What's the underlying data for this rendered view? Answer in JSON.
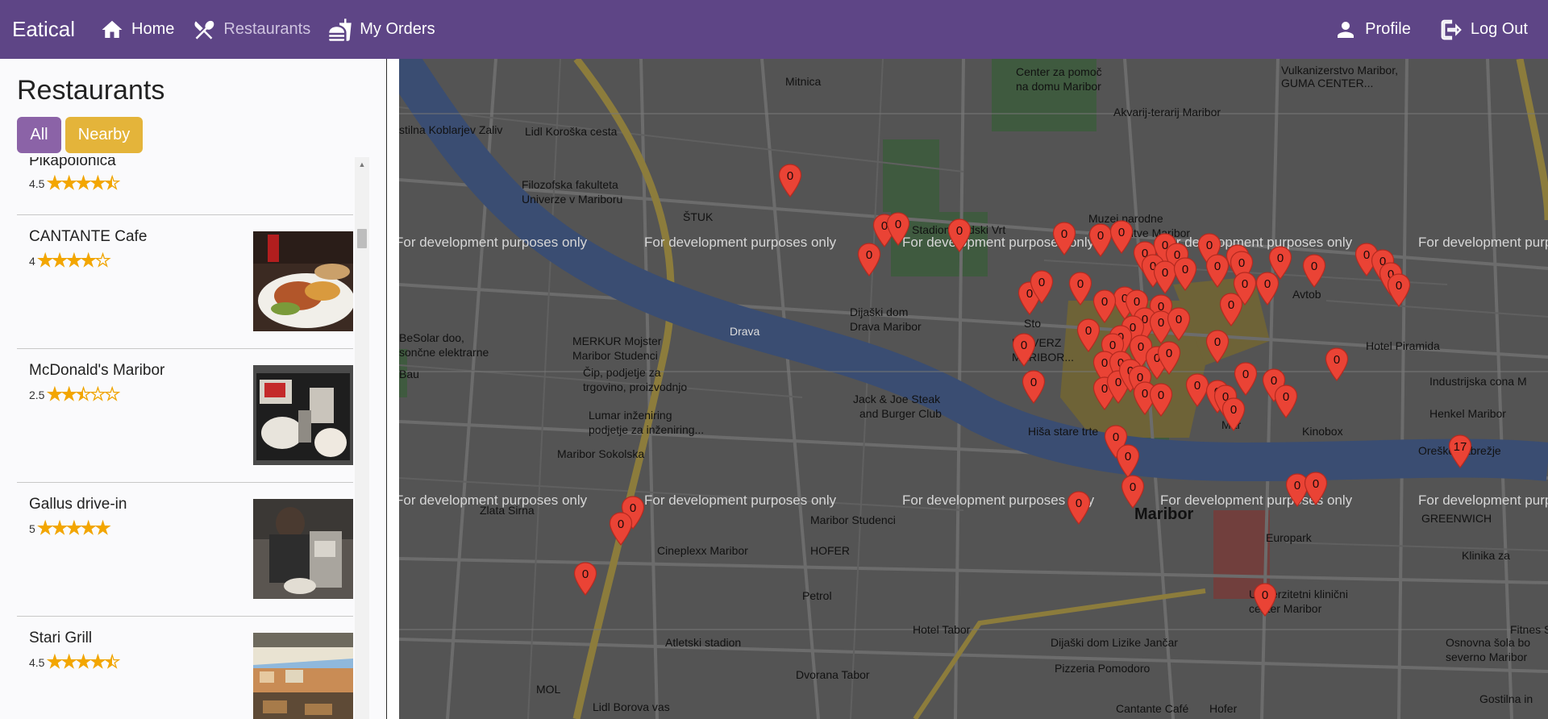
{
  "nav": {
    "brand": "Eatical",
    "home_label": "Home",
    "restaurants_label": "Restaurants",
    "orders_label": "My Orders",
    "profile_label": "Profile",
    "logout_label": "Log Out",
    "color": "#5e4586"
  },
  "sidebar": {
    "title": "Restaurants",
    "filter_all": "All",
    "filter_nearby": "Nearby",
    "restaurants": [
      {
        "name": "Pikapolonica",
        "rating": "4.5",
        "rating_value": 4.5
      },
      {
        "name": "CANTANTE Cafe",
        "rating": "4",
        "rating_value": 4,
        "thumb": "food-plate"
      },
      {
        "name": "McDonald's Maribor",
        "rating": "2.5",
        "rating_value": 2.5,
        "thumb": "fastfood-tray"
      },
      {
        "name": "Gallus drive-in",
        "rating": "5",
        "rating_value": 5,
        "thumb": "coffee-barista"
      },
      {
        "name": "Stari Grill",
        "rating": "4.5",
        "rating_value": 4.5,
        "thumb": "terrace"
      }
    ]
  },
  "map": {
    "watermark": "For development purposes only",
    "labels": {
      "mitnica": "Mitnica",
      "center_pomoc": "Center za pomoč",
      "na_domu": "na domu Maribor",
      "vulkan": "Vulkanizerstvo Maribor,",
      "guma": "GUMA CENTER...",
      "akvarij": "Akvarij-terarij Maribor",
      "lidl_koroska": "Lidl Koroška cesta",
      "filozofska": "Filozofska fakulteta",
      "univerze": "Univerze v Mariboru",
      "stuk": "ŠTUK",
      "stadion": "Stadion Ljudski Vrt",
      "muzej": "Muzej narodne",
      "osvoboditve": "osvoboditve Maribor",
      "dijaski_drava": "Dijaški dom",
      "drava_maribor": "Drava Maribor",
      "mercator": "MERKUR Mojster",
      "mercator2": "Maribor Studenci",
      "besolar": "BeSolar doo,",
      "besolar2": "sončne elektrarne",
      "cip": "Čip, podjetje za",
      "cip2": "trgovino, proizvodnjo",
      "lumar": "Lumar inženiring",
      "lumar2": "podjetje za inženiring...",
      "jack": "Jack & Joe Steak",
      "jack2": "and Burger Club",
      "hisa": "Hiša stare trte",
      "maribor_sokolska": "Maribor Sokolska",
      "zlata_sirna": "Zlata Sirna",
      "maribor_studenci": "Maribor Studenci",
      "cineplexx": "Cineplexx Maribor",
      "hofer": "HOFER",
      "petrol": "Petrol",
      "maribor": "Maribor",
      "europark": "Europark",
      "ukc": "Univerzitetni klinični",
      "ukc2": "center Maribor",
      "kinobox": "Kinobox",
      "hotel_piramida": "Hotel Piramida",
      "industrijska": "Industrijska cona M",
      "henkel": "Henkel Maribor",
      "oresko": "Oreško nabrežje",
      "greenwich": "GREENWICH",
      "klinika": "Klinika za",
      "atletski": "Atletski stadion",
      "hotel_tabor": "Hotel Tabor",
      "dvorana": "Dvorana Tabor",
      "dijaski_jancar": "Dijaški dom Lizike Jančar",
      "pizzeria": "Pizzeria Pomodoro",
      "cantante": "Cantante Café",
      "mol": "MOL",
      "lidl_borova": "Lidl Borova vas",
      "fitnes": "Fitnes Stu",
      "osnovna": "Osnovna šola bo",
      "osnovna2": "severno Maribor",
      "kostilna": "Gostilna in",
      "hofer2": "Hofer",
      "bau": "Bau",
      "kostilna_kob": "stilna Koblarjev Zaliv",
      "drava_river": "Drava",
      "avtob": "Avtob",
      "stoj": "Sto",
      "univerza": "UNIVERZ",
      "univerza2": "MARIBOR...",
      "bar_m": "Mar"
    },
    "markers": [
      {
        "label": "0"
      },
      {
        "label": "0"
      },
      {
        "label": "0"
      },
      {
        "label": "0"
      },
      {
        "label": "0"
      },
      {
        "label": "0"
      },
      {
        "label": "0"
      },
      {
        "label": "0"
      },
      {
        "label": "0"
      },
      {
        "label": "0"
      },
      {
        "label": "0"
      },
      {
        "label": "0"
      },
      {
        "label": "0"
      },
      {
        "label": "0"
      },
      {
        "label": "0"
      },
      {
        "label": "0"
      },
      {
        "label": "0"
      },
      {
        "label": "0"
      },
      {
        "label": "0"
      },
      {
        "label": "0"
      },
      {
        "label": "0"
      },
      {
        "label": "0"
      },
      {
        "label": "0"
      },
      {
        "label": "0"
      },
      {
        "label": "0"
      },
      {
        "label": "0"
      },
      {
        "label": "0"
      },
      {
        "label": "0"
      },
      {
        "label": "0"
      },
      {
        "label": "0"
      },
      {
        "label": "0"
      },
      {
        "label": "0"
      },
      {
        "label": "0"
      },
      {
        "label": "0"
      },
      {
        "label": "0"
      },
      {
        "label": "0"
      },
      {
        "label": "0"
      },
      {
        "label": "0"
      },
      {
        "label": "0"
      },
      {
        "label": "0"
      },
      {
        "label": "0"
      },
      {
        "label": "0"
      },
      {
        "label": "0"
      },
      {
        "label": "0"
      },
      {
        "label": "0"
      },
      {
        "label": "0"
      },
      {
        "label": "0"
      },
      {
        "label": "0"
      },
      {
        "label": "0"
      },
      {
        "label": "0"
      },
      {
        "label": "0"
      },
      {
        "label": "0"
      },
      {
        "label": "0"
      },
      {
        "label": "0"
      },
      {
        "label": "0"
      },
      {
        "label": "0"
      },
      {
        "label": "0"
      },
      {
        "label": "0"
      },
      {
        "label": "0"
      },
      {
        "label": "0"
      },
      {
        "label": "0"
      },
      {
        "label": "0"
      },
      {
        "label": "0"
      },
      {
        "label": "0"
      },
      {
        "label": "0"
      },
      {
        "label": "0"
      },
      {
        "label": "0"
      },
      {
        "label": "0"
      },
      {
        "label": "0"
      },
      {
        "label": "0"
      },
      {
        "label": "0"
      },
      {
        "label": "0"
      },
      {
        "label": "0"
      },
      {
        "label": "17"
      }
    ],
    "marker_color": "#ea4335"
  }
}
